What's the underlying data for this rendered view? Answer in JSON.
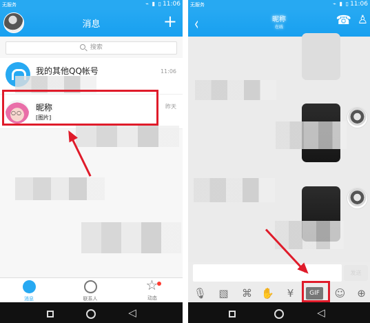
{
  "left": {
    "status": {
      "carrier": "无服务",
      "time": "11:06"
    },
    "header": {
      "title": "消息",
      "plus": "+"
    },
    "search": {
      "placeholder": "搜索"
    },
    "conversations": [
      {
        "name": "我的其他QQ帐号",
        "time": "11:06"
      },
      {
        "name": "昵称",
        "time": "昨天",
        "preview": "[图片]"
      }
    ],
    "tabs": [
      {
        "label": "消息"
      },
      {
        "label": "联系人"
      },
      {
        "label": "动态"
      }
    ]
  },
  "right": {
    "status": {
      "carrier": "无服务",
      "time": "11:06"
    },
    "header": {
      "name": "昵称",
      "subtitle": "在线"
    },
    "input": {
      "send_label": "发送"
    },
    "toolbar": {
      "icons": [
        "microphone-icon",
        "image-icon",
        "camera-icon",
        "red-packet-icon",
        "emoji-sticker-icon",
        "gif-icon",
        "smile-icon",
        "plus-icon"
      ],
      "gif_label": "GIF"
    }
  },
  "colors": {
    "accent": "#27a9f2",
    "highlight": "#df1b2a"
  }
}
